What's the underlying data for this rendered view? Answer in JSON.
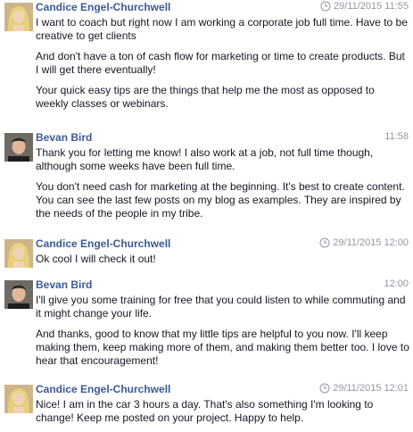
{
  "messages": [
    {
      "sender": "Candice Engel-Churchwell",
      "avatar": "candice-avatar",
      "date": "29/11/2015",
      "time": "11:55",
      "show_clock": true,
      "paragraphs": [
        "I want to coach but right now I am working a corporate job full time. Have to be creative to get clients",
        "And don't have a ton of cash flow for marketing or time to create products. But I will get there eventually!",
        "Your quick easy tips are the things that help me the most as opposed to weekly classes or webinars."
      ]
    },
    {
      "sender": "Bevan Bird",
      "avatar": "bevan-avatar",
      "date": "",
      "time": "11:58",
      "show_clock": false,
      "paragraphs": [
        "Thank you for letting me know! I also work at a job, not full time though, although some weeks have been full time.",
        "You don't need cash for marketing at the beginning. It's best to create content. You can see the last few posts on my blog as examples. They are inspired by the needs of the people in my tribe."
      ]
    },
    {
      "sender": "Candice Engel-Churchwell",
      "avatar": "candice-avatar",
      "date": "29/11/2015",
      "time": "12:00",
      "show_clock": true,
      "paragraphs": [
        "Ok cool I will check it out!"
      ]
    },
    {
      "sender": "Bevan Bird",
      "avatar": "bevan-avatar",
      "date": "",
      "time": "12:00",
      "show_clock": false,
      "paragraphs": [
        "I'll give you some training for free that you could listen to while commuting and it might change your life.",
        "And thanks, good to know that my little tips are helpful to you now. I'll keep making them, keep making more of them, and making them better too. I love to hear that encouragement!"
      ]
    },
    {
      "sender": "Candice Engel-Churchwell",
      "avatar": "candice-avatar",
      "date": "29/11/2015",
      "time": "12:01",
      "show_clock": true,
      "paragraphs": [
        "Nice! I am in the car 3 hours a day. That's also something I'm looking to change! Keep me posted on your project. Happy to help."
      ]
    }
  ]
}
